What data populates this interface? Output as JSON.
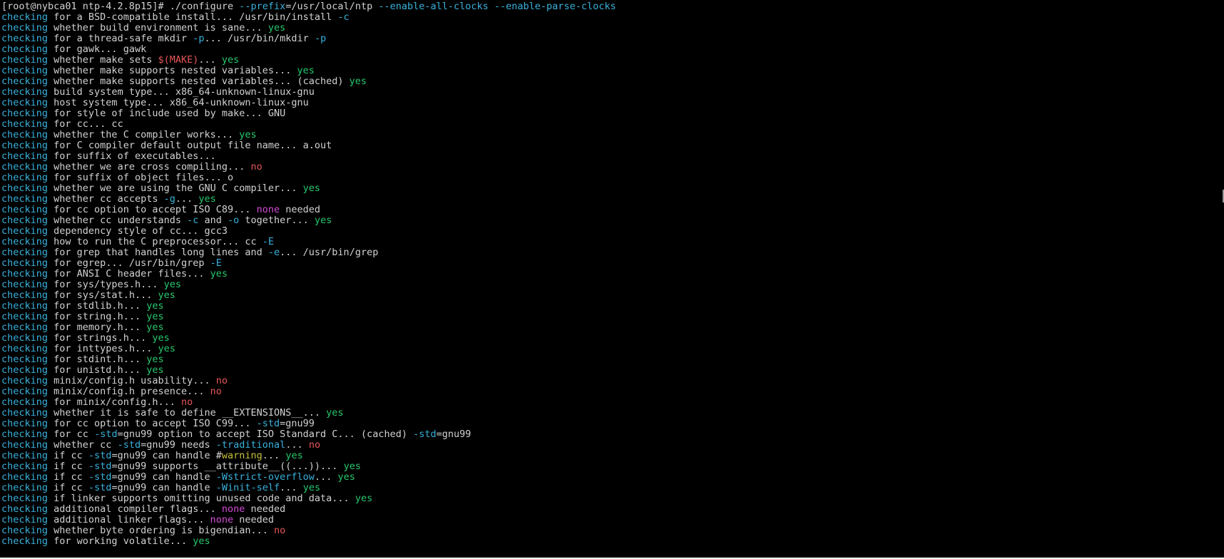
{
  "window": {
    "prompt": "[root@nybca01 ntp-4.2.8p15]#",
    "command": "./configure --prefix=/usr/local/ntp --enable-all-clocks --enable-parse-clocks"
  },
  "colors": {
    "background": "#000000",
    "text": "#d2d2d2",
    "keyword": "#39b1dc",
    "yes": "#27c96e",
    "no": "#e65656",
    "none": "#d44bd7",
    "warning": "#c6c13b"
  },
  "lines": [
    [
      [
        "t",
        "[root@nybca01 ntp-4.2.8p15]# ./configure "
      ],
      [
        "o",
        "--prefix"
      ],
      [
        "t",
        "=/usr/local/ntp "
      ],
      [
        "o",
        "--enable-all-clocks"
      ],
      [
        "t",
        " "
      ],
      [
        "o",
        "--enable-parse-clocks"
      ]
    ],
    [
      [
        "k",
        "checking"
      ],
      [
        "t",
        " for a BSD-compatible install... /usr/bin/install "
      ],
      [
        "o",
        "-c"
      ]
    ],
    [
      [
        "k",
        "checking"
      ],
      [
        "t",
        " whether build environment is sane... "
      ],
      [
        "yes",
        "yes"
      ]
    ],
    [
      [
        "k",
        "checking"
      ],
      [
        "t",
        " for a thread-safe mkdir "
      ],
      [
        "o",
        "-p"
      ],
      [
        "t",
        "... /usr/bin/mkdir "
      ],
      [
        "o",
        "-p"
      ]
    ],
    [
      [
        "k",
        "checking"
      ],
      [
        "t",
        " for gawk... gawk"
      ]
    ],
    [
      [
        "k",
        "checking"
      ],
      [
        "t",
        " whether make sets "
      ],
      [
        "make",
        "$(MAKE)"
      ],
      [
        "t",
        "... "
      ],
      [
        "yes",
        "yes"
      ]
    ],
    [
      [
        "k",
        "checking"
      ],
      [
        "t",
        " whether make supports nested variables... "
      ],
      [
        "yes",
        "yes"
      ]
    ],
    [
      [
        "k",
        "checking"
      ],
      [
        "t",
        " whether make supports nested variables... (cached) "
      ],
      [
        "yes",
        "yes"
      ]
    ],
    [
      [
        "k",
        "checking"
      ],
      [
        "t",
        " build system type... x86_64-unknown-linux-gnu"
      ]
    ],
    [
      [
        "k",
        "checking"
      ],
      [
        "t",
        " host system type... x86_64-unknown-linux-gnu"
      ]
    ],
    [
      [
        "k",
        "checking"
      ],
      [
        "t",
        " for style of include used by make... GNU"
      ]
    ],
    [
      [
        "k",
        "checking"
      ],
      [
        "t",
        " for cc... cc"
      ]
    ],
    [
      [
        "k",
        "checking"
      ],
      [
        "t",
        " whether the C compiler works... "
      ],
      [
        "yes",
        "yes"
      ]
    ],
    [
      [
        "k",
        "checking"
      ],
      [
        "t",
        " for C compiler default output file name... a.out"
      ]
    ],
    [
      [
        "k",
        "checking"
      ],
      [
        "t",
        " for suffix of executables..."
      ]
    ],
    [
      [
        "k",
        "checking"
      ],
      [
        "t",
        " whether we are cross compiling... "
      ],
      [
        "no",
        "no"
      ]
    ],
    [
      [
        "k",
        "checking"
      ],
      [
        "t",
        " for suffix of object files... o"
      ]
    ],
    [
      [
        "k",
        "checking"
      ],
      [
        "t",
        " whether we are using the GNU C compiler... "
      ],
      [
        "yes",
        "yes"
      ]
    ],
    [
      [
        "k",
        "checking"
      ],
      [
        "t",
        " whether cc accepts "
      ],
      [
        "o",
        "-g"
      ],
      [
        "t",
        "... "
      ],
      [
        "yes",
        "yes"
      ]
    ],
    [
      [
        "k",
        "checking"
      ],
      [
        "t",
        " for cc option to accept ISO C89... "
      ],
      [
        "none",
        "none"
      ],
      [
        "t",
        " needed"
      ]
    ],
    [
      [
        "k",
        "checking"
      ],
      [
        "t",
        " whether cc understands "
      ],
      [
        "o",
        "-c"
      ],
      [
        "t",
        " and "
      ],
      [
        "o",
        "-o"
      ],
      [
        "t",
        " together... "
      ],
      [
        "yes",
        "yes"
      ]
    ],
    [
      [
        "k",
        "checking"
      ],
      [
        "t",
        " dependency style of cc... gcc3"
      ]
    ],
    [
      [
        "k",
        "checking"
      ],
      [
        "t",
        " how to run the C preprocessor... cc "
      ],
      [
        "o",
        "-E"
      ]
    ],
    [
      [
        "k",
        "checking"
      ],
      [
        "t",
        " for grep that handles long lines and "
      ],
      [
        "o",
        "-e"
      ],
      [
        "t",
        "... /usr/bin/grep"
      ]
    ],
    [
      [
        "k",
        "checking"
      ],
      [
        "t",
        " for egrep... /usr/bin/grep "
      ],
      [
        "o",
        "-E"
      ]
    ],
    [
      [
        "k",
        "checking"
      ],
      [
        "t",
        " for ANSI C header files... "
      ],
      [
        "yes",
        "yes"
      ]
    ],
    [
      [
        "k",
        "checking"
      ],
      [
        "t",
        " for sys/types.h... "
      ],
      [
        "yes",
        "yes"
      ]
    ],
    [
      [
        "k",
        "checking"
      ],
      [
        "t",
        " for sys/stat.h... "
      ],
      [
        "yes",
        "yes"
      ]
    ],
    [
      [
        "k",
        "checking"
      ],
      [
        "t",
        " for stdlib.h... "
      ],
      [
        "yes",
        "yes"
      ]
    ],
    [
      [
        "k",
        "checking"
      ],
      [
        "t",
        " for string.h... "
      ],
      [
        "yes",
        "yes"
      ]
    ],
    [
      [
        "k",
        "checking"
      ],
      [
        "t",
        " for memory.h... "
      ],
      [
        "yes",
        "yes"
      ]
    ],
    [
      [
        "k",
        "checking"
      ],
      [
        "t",
        " for strings.h... "
      ],
      [
        "yes",
        "yes"
      ]
    ],
    [
      [
        "k",
        "checking"
      ],
      [
        "t",
        " for inttypes.h... "
      ],
      [
        "yes",
        "yes"
      ]
    ],
    [
      [
        "k",
        "checking"
      ],
      [
        "t",
        " for stdint.h... "
      ],
      [
        "yes",
        "yes"
      ]
    ],
    [
      [
        "k",
        "checking"
      ],
      [
        "t",
        " for unistd.h... "
      ],
      [
        "yes",
        "yes"
      ]
    ],
    [
      [
        "k",
        "checking"
      ],
      [
        "t",
        " minix/config.h usability... "
      ],
      [
        "no",
        "no"
      ]
    ],
    [
      [
        "k",
        "checking"
      ],
      [
        "t",
        " minix/config.h presence... "
      ],
      [
        "no",
        "no"
      ]
    ],
    [
      [
        "k",
        "checking"
      ],
      [
        "t",
        " for minix/config.h... "
      ],
      [
        "no",
        "no"
      ]
    ],
    [
      [
        "k",
        "checking"
      ],
      [
        "t",
        " whether it is safe to define __EXTENSIONS__... "
      ],
      [
        "yes",
        "yes"
      ]
    ],
    [
      [
        "k",
        "checking"
      ],
      [
        "t",
        " for cc option to accept ISO C99... "
      ],
      [
        "o",
        "-std"
      ],
      [
        "t",
        "=gnu99"
      ]
    ],
    [
      [
        "k",
        "checking"
      ],
      [
        "t",
        " for cc "
      ],
      [
        "o",
        "-std"
      ],
      [
        "t",
        "=gnu99 option to accept ISO Standard C... (cached) "
      ],
      [
        "o",
        "-std"
      ],
      [
        "t",
        "=gnu99"
      ]
    ],
    [
      [
        "k",
        "checking"
      ],
      [
        "t",
        " whether cc "
      ],
      [
        "o",
        "-std"
      ],
      [
        "t",
        "=gnu99 needs "
      ],
      [
        "o",
        "-traditional"
      ],
      [
        "t",
        "... "
      ],
      [
        "no",
        "no"
      ]
    ],
    [
      [
        "k",
        "checking"
      ],
      [
        "t",
        " if cc "
      ],
      [
        "o",
        "-std"
      ],
      [
        "t",
        "=gnu99 can handle #"
      ],
      [
        "warn",
        "warning"
      ],
      [
        "t",
        "... "
      ],
      [
        "yes",
        "yes"
      ]
    ],
    [
      [
        "k",
        "checking"
      ],
      [
        "t",
        " if cc "
      ],
      [
        "o",
        "-std"
      ],
      [
        "t",
        "=gnu99 supports __attribute__((...))... "
      ],
      [
        "yes",
        "yes"
      ]
    ],
    [
      [
        "k",
        "checking"
      ],
      [
        "t",
        " if cc "
      ],
      [
        "o",
        "-std"
      ],
      [
        "t",
        "=gnu99 can handle "
      ],
      [
        "o",
        "-Wstrict-overflow"
      ],
      [
        "t",
        "... "
      ],
      [
        "yes",
        "yes"
      ]
    ],
    [
      [
        "k",
        "checking"
      ],
      [
        "t",
        " if cc "
      ],
      [
        "o",
        "-std"
      ],
      [
        "t",
        "=gnu99 can handle "
      ],
      [
        "o",
        "-Winit-self"
      ],
      [
        "t",
        "... "
      ],
      [
        "yes",
        "yes"
      ]
    ],
    [
      [
        "k",
        "checking"
      ],
      [
        "t",
        " if linker supports omitting unused code and data... "
      ],
      [
        "yes",
        "yes"
      ]
    ],
    [
      [
        "k",
        "checking"
      ],
      [
        "t",
        " additional compiler flags... "
      ],
      [
        "none",
        "none"
      ],
      [
        "t",
        " needed"
      ]
    ],
    [
      [
        "k",
        "checking"
      ],
      [
        "t",
        " additional linker flags... "
      ],
      [
        "none",
        "none"
      ],
      [
        "t",
        " needed"
      ]
    ],
    [
      [
        "k",
        "checking"
      ],
      [
        "t",
        " whether byte ordering is bigendian... "
      ],
      [
        "no",
        "no"
      ]
    ],
    [
      [
        "k",
        "checking"
      ],
      [
        "t",
        " for working volatile... "
      ],
      [
        "yes",
        "yes"
      ]
    ]
  ]
}
